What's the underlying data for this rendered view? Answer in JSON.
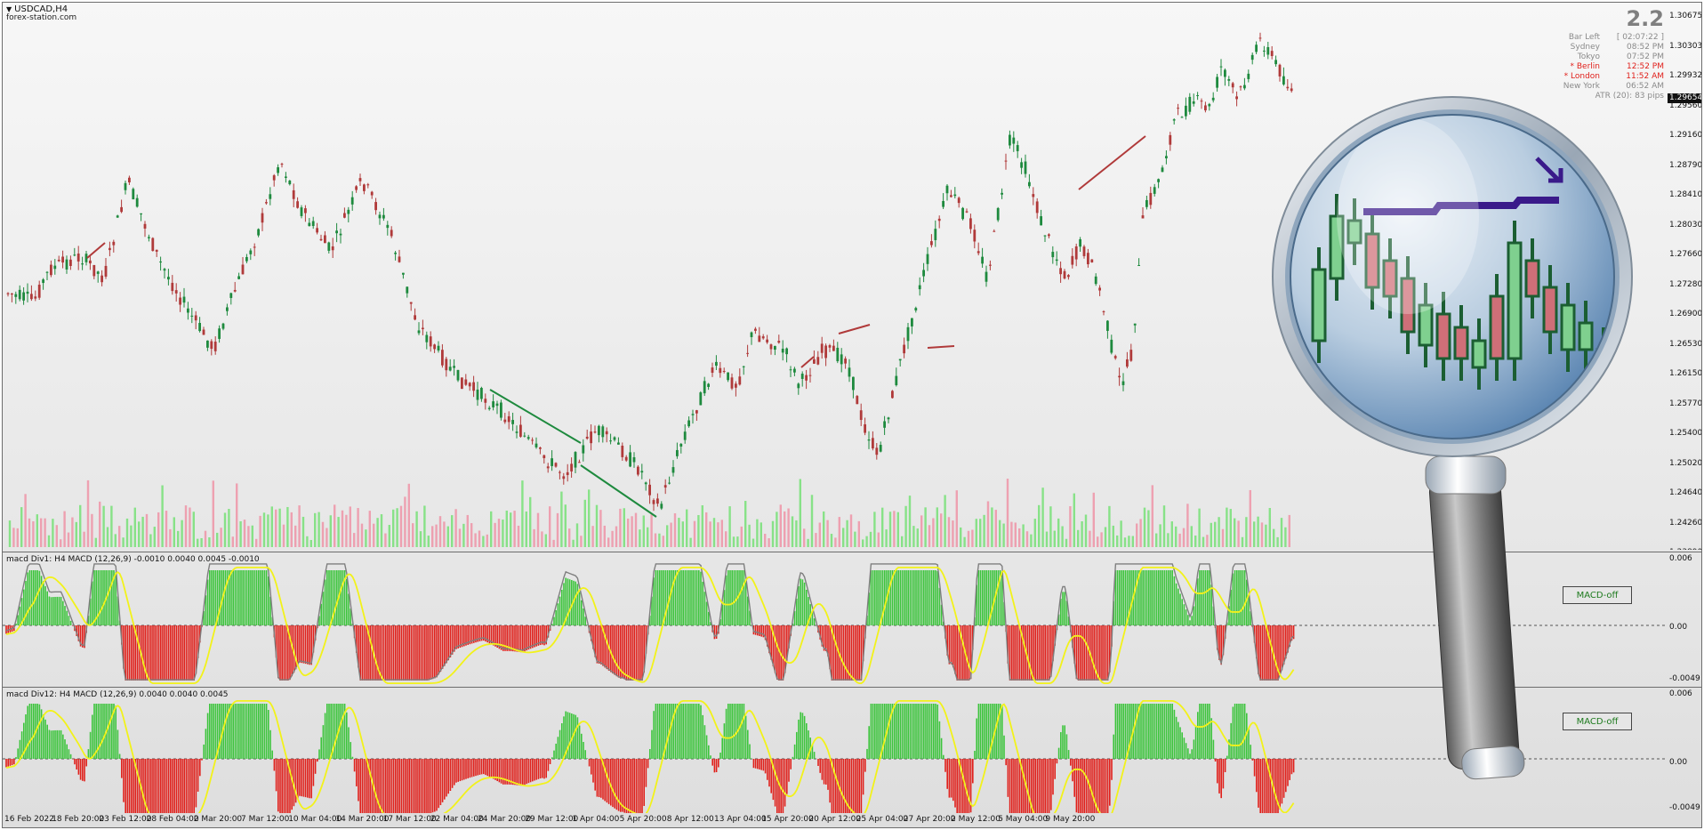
{
  "chart": {
    "symbol": "USDCAD,H4",
    "watermark": "forex-station.com",
    "current_price": "1.29654",
    "price_labels": [
      "1.30675",
      "1.30303",
      "1.29932",
      "1.29560",
      "1.29160",
      "1.28790",
      "1.28410",
      "1.28030",
      "1.27660",
      "1.27280",
      "1.26900",
      "1.26530",
      "1.26150",
      "1.25770",
      "1.25400",
      "1.25020",
      "1.24640",
      "1.24260",
      "1.23890"
    ],
    "date_labels": [
      "16 Feb 2022",
      "18 Feb 20:00",
      "23 Feb 12:00",
      "28 Feb 04:00",
      "2 Mar 20:00",
      "7 Mar 12:00",
      "10 Mar 04:00",
      "14 Mar 20:00",
      "17 Mar 12:00",
      "22 Mar 04:00",
      "24 Mar 20:00",
      "29 Mar 12:00",
      "1 Apr 04:00",
      "5 Apr 20:00",
      "8 Apr 12:00",
      "13 Apr 04:00",
      "15 Apr 20:00",
      "20 Apr 12:00",
      "25 Apr 04:00",
      "27 Apr 20:00",
      "2 May 12:00",
      "5 May 04:00",
      "9 May 20:00"
    ]
  },
  "session_panel": {
    "version": "2.2",
    "rows": [
      {
        "label": "Bar Left",
        "value": "[ 02:07:22 ]",
        "highlight": false
      },
      {
        "label": "Sydney",
        "value": "08:52 PM",
        "highlight": false
      },
      {
        "label": "Tokyo",
        "value": "07:52 PM",
        "highlight": false
      },
      {
        "label": "* Berlin",
        "value": "12:52 PM",
        "highlight": true
      },
      {
        "label": "* London",
        "value": "11:52 AM",
        "highlight": true
      },
      {
        "label": "New York",
        "value": "06:52 AM",
        "highlight": false
      }
    ],
    "atr": "ATR (20): 83 pips"
  },
  "indicator1": {
    "title": "macd Div1: H4 MACD (12,26,9) -0.0010 0.0040 0.0045 -0.0010",
    "axis_labels": [
      "0.006",
      "0.00",
      "-0.0049"
    ],
    "button_label": "MACD-off"
  },
  "indicator2": {
    "title": "macd Div12: H4 MACD (12,26,9) 0.0040 0.0040 0.0045",
    "axis_labels": [
      "0.006",
      "0.00",
      "-0.0049"
    ],
    "button_label": "MACD-off"
  },
  "colors": {
    "bull": "#1e8a3e",
    "bear": "#b03a3a",
    "hist_up": "#3cc43c",
    "hist_down": "#e0201b",
    "signal": "#f2f21a",
    "macd_line": "#7f7f7f",
    "bear_div": "#3a1a8a",
    "bull_div": "#1e6a1e"
  },
  "icons": {
    "magnifier": "magnifier-icon",
    "dropdown": "triangle-down-icon"
  }
}
